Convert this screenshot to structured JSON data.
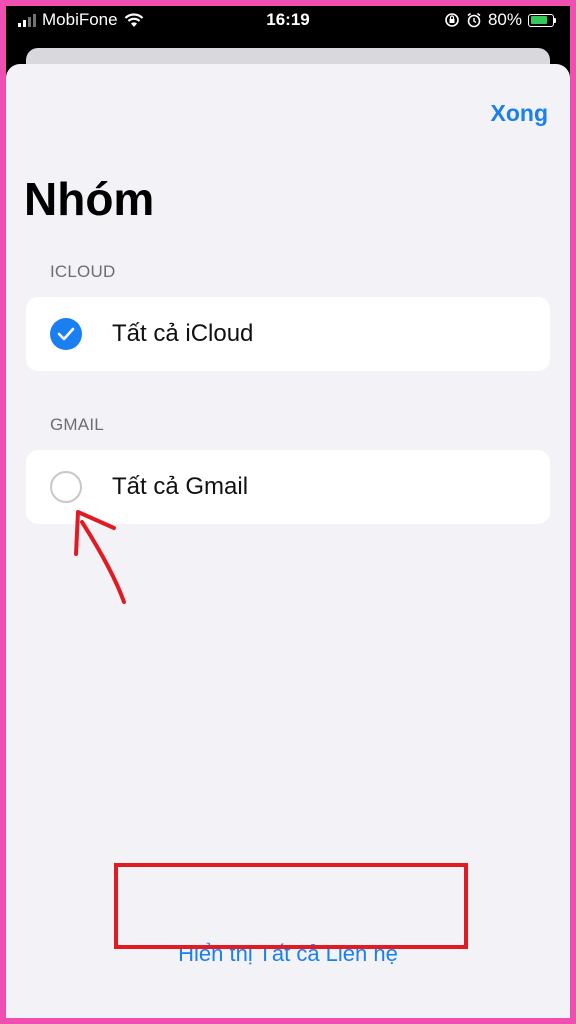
{
  "status_bar": {
    "carrier": "MobiFone",
    "time": "16:19",
    "battery": "80%",
    "battery_level": 0.8,
    "battery_color": "#34c759"
  },
  "header": {
    "done_label": "Xong",
    "title": "Nhóm"
  },
  "groups": [
    {
      "section": "ICLOUD",
      "label": "Tất cả iCloud",
      "selected": true
    },
    {
      "section": "GMAIL",
      "label": "Tất cả Gmail",
      "selected": false
    }
  ],
  "footer": {
    "show_all_label": "Hiển thị Tất cả Liên hệ"
  },
  "colors": {
    "accent": "#1a7ff0",
    "annotation": "#e21b23",
    "frame": "#ef4fb0"
  }
}
